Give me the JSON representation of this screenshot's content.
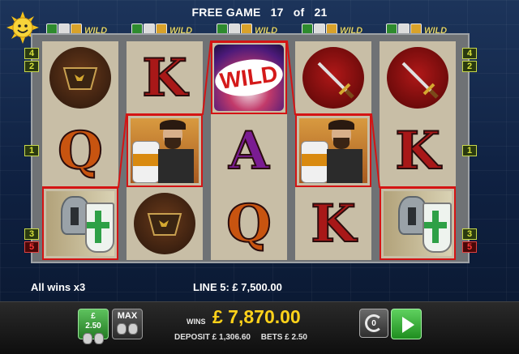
{
  "header": {
    "prefix": "FREE GAME",
    "current": "17",
    "of": "of",
    "total": "21"
  },
  "bonus_label": "WILD",
  "reels": [
    [
      "horn",
      "Q",
      "knight"
    ],
    [
      "K",
      "noble",
      "horn"
    ],
    [
      "wild",
      "A",
      "Q"
    ],
    [
      "sword",
      "noble",
      "K"
    ],
    [
      "sword",
      "K",
      "knight"
    ]
  ],
  "wild_text": "WILD",
  "line_markers_left": [
    "4",
    "2",
    "1",
    "3",
    "5"
  ],
  "line_markers_right": [
    "4",
    "2",
    "1",
    "3",
    "5"
  ],
  "status": {
    "all_wins": "All wins x3",
    "line_win": "LINE 5: £ 7,500.00"
  },
  "controls": {
    "stake_currency": "£",
    "stake_value": "2.50",
    "max_label": "MAX",
    "wins_label": "WINS",
    "wins_value": "£ 7,870.00",
    "deposit_label": "DEPOSIT £ 1,306.60",
    "bets_label": "BETS £ 2.50",
    "autoplay_count": "0"
  },
  "colors": {
    "win_highlight": "#d41414",
    "wins_value": "#ffd21a",
    "play": "#2fae2f"
  }
}
